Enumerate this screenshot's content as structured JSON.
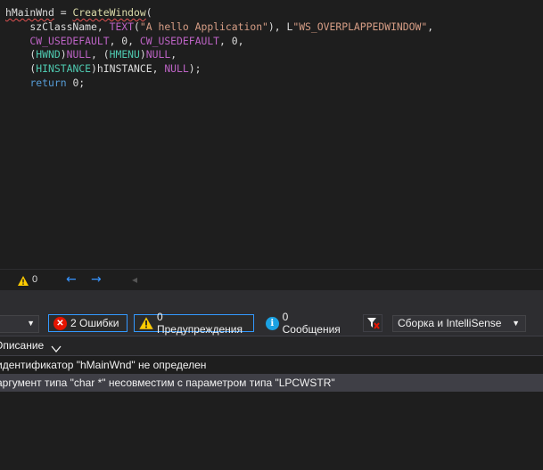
{
  "editor": {
    "lines": [
      [
        "hMainWnd",
        " = ",
        "CreateWindow",
        "("
      ],
      [
        "    szClassName, ",
        "TEXT",
        "(",
        "\"A hello Application\"",
        "), L",
        "\"WS_OVERPLAPPEDWINDOW\"",
        ","
      ],
      [
        "    CW_USEDEFAULT",
        ", 0, ",
        "CW_USEDEFAULT",
        ", 0,"
      ],
      [
        "    (",
        "HWND",
        ")",
        "NULL",
        ", (",
        "HMENU",
        ")",
        "NULL",
        ","
      ],
      [
        "    (",
        "HINSTANCE",
        ")hINSTANCE, ",
        "NULL",
        ");"
      ],
      [
        "    ",
        "return",
        " 0;"
      ]
    ]
  },
  "editor_status": {
    "warning_count": "0",
    "back_icon": "arrow-left-icon",
    "forward_icon": "arrow-right-icon"
  },
  "toolbar": {
    "errors_label": "2 Ошибки",
    "warnings_label": "0 Предупреждения",
    "messages_label": "0 Сообщения",
    "build_filter": "Сборка и IntelliSense"
  },
  "list": {
    "header": "Описание",
    "rows": [
      "идентификатор \"hMainWnd\" не определен",
      "аргумент типа \"char *\" несовместим с параметром типа \"LPCWSTR\""
    ]
  },
  "colors": {
    "error": "#e51400",
    "warning": "#ffcc00",
    "info": "#1ba1e2",
    "accent": "#3399ff"
  }
}
